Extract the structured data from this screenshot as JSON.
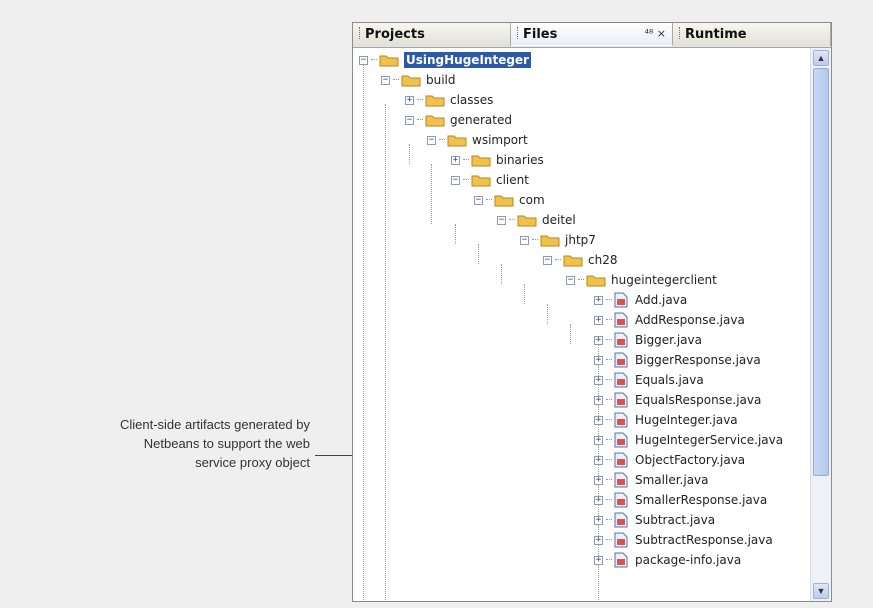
{
  "callout": {
    "text_line1": "Client-side artifacts generated by",
    "text_line2": "Netbeans to support the web",
    "text_line3": "service proxy object"
  },
  "tabs": {
    "projects": "Projects",
    "files": "Files",
    "files_controls": "⁴⁸ ×",
    "runtime": "Runtime"
  },
  "tree": {
    "root": "UsingHugeInteger",
    "build": "build",
    "classes": "classes",
    "generated": "generated",
    "wsimport": "wsimport",
    "binaries": "binaries",
    "client": "client",
    "com": "com",
    "deitel": "deitel",
    "jhtp7": "jhtp7",
    "ch28": "ch28",
    "hugeintegerclient": "hugeintegerclient",
    "files": [
      "Add.java",
      "AddResponse.java",
      "Bigger.java",
      "BiggerResponse.java",
      "Equals.java",
      "EqualsResponse.java",
      "HugeInteger.java",
      "HugeIntegerService.java",
      "ObjectFactory.java",
      "Smaller.java",
      "SmallerResponse.java",
      "Subtract.java",
      "SubtractResponse.java",
      "package-info.java"
    ]
  },
  "colors": {
    "selection": "#2c5aa8",
    "folder": "#f0c24c",
    "scrollbar_thumb": "#b3c8f0"
  }
}
